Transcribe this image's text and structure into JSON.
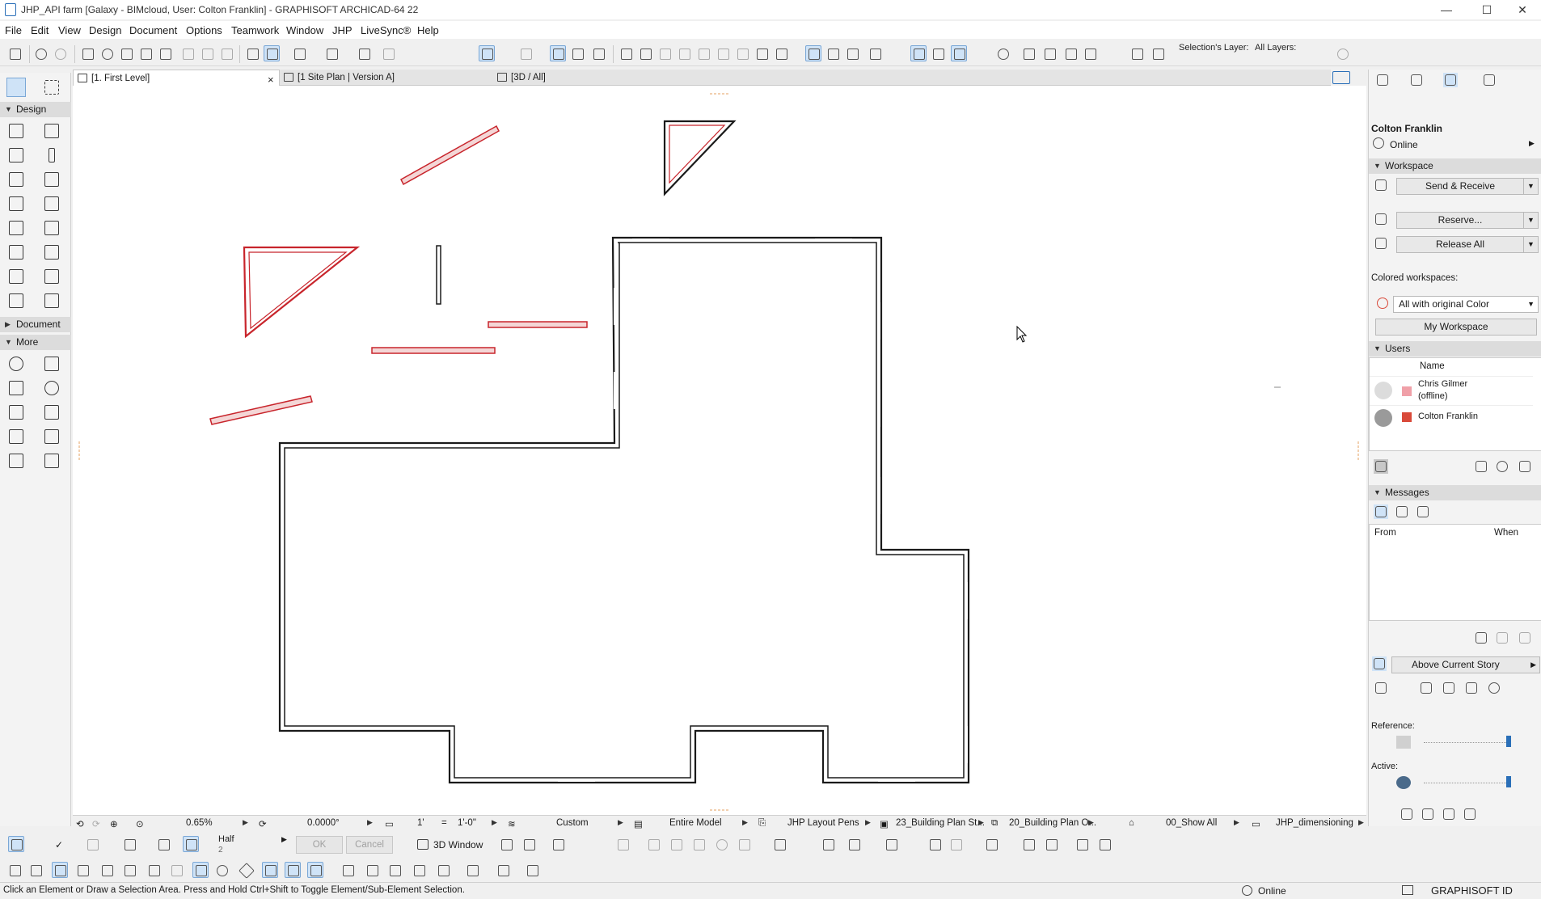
{
  "window": {
    "title": "JHP_API farm [Galaxy - BIMcloud, User: Colton Franklin] - GRAPHISOFT ARCHICAD-64 22",
    "minimize": "—",
    "maximize": "☐",
    "close": "✕"
  },
  "menu": [
    "File",
    "Edit",
    "View",
    "Design",
    "Document",
    "Options",
    "Teamwork",
    "Window",
    "JHP",
    "LiveSync®",
    "Help"
  ],
  "layers": {
    "selection_label": "Selection's Layer:",
    "all_label": "All Layers:"
  },
  "tabs": [
    {
      "label": "[1. First Level]",
      "active": true
    },
    {
      "label": "[1 Site Plan | Version A]",
      "active": false
    },
    {
      "label": "[3D / All]",
      "active": false
    }
  ],
  "tab_close": "×",
  "toolbox": {
    "design": "Design",
    "document": "Document",
    "more": "More"
  },
  "right_panel": {
    "user": "Colton Franklin",
    "status": "Online",
    "workspace_head": "Workspace",
    "send_receive": "Send & Receive",
    "reserve": "Reserve...",
    "release_all": "Release All",
    "colored_label": "Colored workspaces:",
    "colored_value": "All with original Color",
    "my_workspace": "My Workspace",
    "users_head": "Users",
    "users_col": "Name",
    "users": [
      {
        "name": "Chris Gilmer (offline)",
        "color": "#f0a0a8"
      },
      {
        "name": "Colton Franklin",
        "color": "#d94a3a"
      }
    ],
    "messages_head": "Messages",
    "from_col": "From",
    "when_col": "When",
    "above_story": "Above Current Story",
    "reference": "Reference:",
    "active": "Active:"
  },
  "statusbar1": {
    "zoom": "0.65%",
    "angle": "0.0000°",
    "scale_a": "1'",
    "scale_eq": "=",
    "scale_b": "1'-0\"",
    "custom": "Custom",
    "entire_model": "Entire Model",
    "pens": "JHP Layout Pens",
    "building_a": "23_Building Plan St...",
    "building_b": "20_Building Plan O...",
    "show_all": "00_Show All",
    "dimensioning": "JHP_dimensioning"
  },
  "toolbar2": {
    "half": "Half",
    "half_sub": "2",
    "ok": "OK",
    "cancel": "Cancel",
    "window3d": "3D Window"
  },
  "status": {
    "hint": "Click an Element or Draw a Selection Area. Press and Hold Ctrl+Shift to Toggle Element/Sub-Element Selection.",
    "online": "Online",
    "graphisoft": "GRAPHISOFT ID"
  },
  "colors": {
    "accent": "#cfe3f7",
    "wall": "#1a1a1a",
    "highlight": "#c8252c"
  }
}
